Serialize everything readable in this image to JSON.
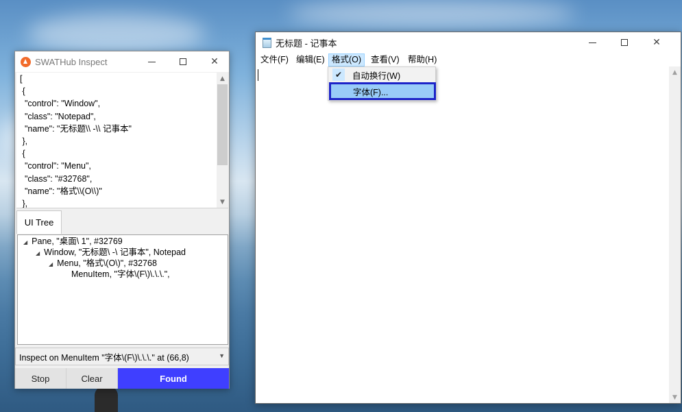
{
  "inspect": {
    "title": "SWATHub Inspect",
    "json_lines": [
      "[",
      " {",
      "  \"control\": \"Window\",",
      "  \"class\": \"Notepad\",",
      "  \"name\": \"无标题\\\\ -\\\\ 记事本\"",
      " },",
      " {",
      "  \"control\": \"Menu\",",
      "  \"class\": \"#32768\",",
      "  \"name\": \"格式\\\\(O\\\\)\"",
      " },"
    ],
    "tab_label": "UI Tree",
    "tree": [
      "Pane, \"桌面\\ 1\", #32769",
      "Window, \"无标题\\ -\\ 记事本\", Notepad",
      "Menu, \"格式\\(O\\)\", #32768",
      "MenuItem, \"字体\\(F\\)\\.\\.\\.\","
    ],
    "status": "Inspect on MenuItem \"字体\\(F\\)\\.\\.\\.\" at (66,8)",
    "buttons": {
      "stop": "Stop",
      "clear": "Clear",
      "found": "Found"
    },
    "found_color": "#3f3fff"
  },
  "notepad": {
    "title": "无标题 - 记事本",
    "menus": [
      "文件(F)",
      "编辑(E)",
      "格式(O)",
      "查看(V)",
      "帮助(H)"
    ],
    "open_menu": "格式(O)",
    "format_menu": {
      "items": [
        {
          "label": "自动换行(W)",
          "checked": true
        },
        {
          "label": "字体(F)...",
          "highlighted": true
        }
      ]
    },
    "highlight_border_color": "#1c23c8"
  }
}
